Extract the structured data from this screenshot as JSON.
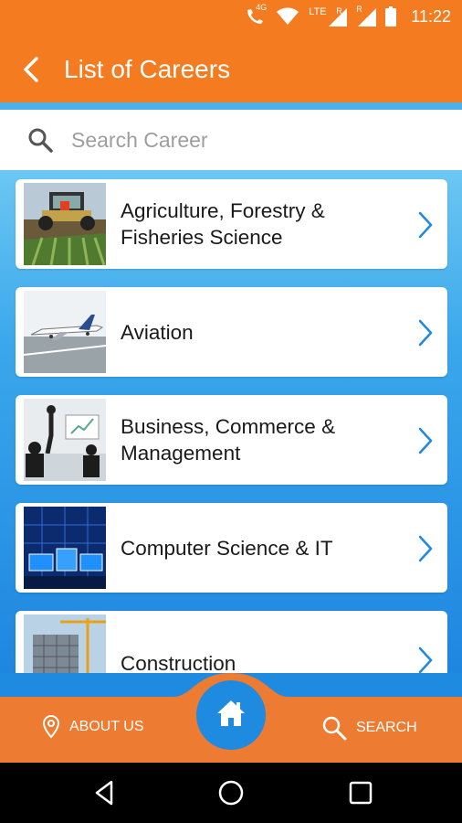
{
  "status_bar": {
    "time": "11:22",
    "network_badge": "4G",
    "lte_label": "LTE",
    "roaming_label": "R",
    "icons": [
      "call-4g-icon",
      "wifi-icon",
      "signal-lte-icon",
      "signal-icon",
      "battery-icon"
    ]
  },
  "app_bar": {
    "title": "List of Careers",
    "back_icon": "back-arrow-icon"
  },
  "search": {
    "placeholder": "Search Career",
    "icon": "search-icon"
  },
  "careers": [
    {
      "label": "Agriculture, Forestry & Fisheries Science",
      "thumbnail": "tractor-field-photo"
    },
    {
      "label": "Aviation",
      "thumbnail": "airplane-runway-photo"
    },
    {
      "label": "Business, Commerce & Management",
      "thumbnail": "business-meeting-photo"
    },
    {
      "label": "Computer Science & IT",
      "thumbnail": "computer-monitors-photo"
    },
    {
      "label": "Construction",
      "thumbnail": "building-crane-photo"
    }
  ],
  "bottom_nav": {
    "about_label": "ABOUT US",
    "search_label": "SEARCH",
    "home_icon": "home-icon"
  },
  "colors": {
    "brand_orange": "#f47b20",
    "brand_blue": "#1f8be0",
    "nav_orange": "#ee7b32"
  }
}
